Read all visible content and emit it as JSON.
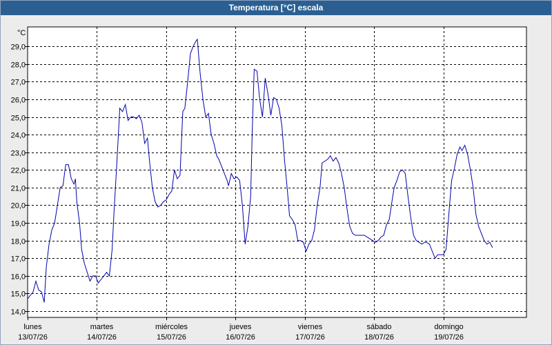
{
  "window": {
    "title": "Temperatura [°C] escala"
  },
  "chart_data": {
    "type": "line",
    "title": "Temperatura [°C] escala",
    "ylabel": "°C",
    "ylim": [
      13.65,
      30.1
    ],
    "yticks": [
      "14,0",
      "15,0",
      "16,0",
      "17,0",
      "18,0",
      "19,0",
      "20,0",
      "21,0",
      "22,0",
      "23,0",
      "24,0",
      "25,0",
      "26,0",
      "27,0",
      "28,0",
      "29,0"
    ],
    "yticks_values": [
      14,
      15,
      16,
      17,
      18,
      19,
      20,
      21,
      22,
      23,
      24,
      25,
      26,
      27,
      28,
      29
    ],
    "xlim": [
      0,
      7.2
    ],
    "xticks_values": [
      0,
      1,
      2,
      3,
      4,
      5,
      6
    ],
    "categories": [
      {
        "day": "lunes",
        "date": "13/07/26"
      },
      {
        "day": "martes",
        "date": "14/07/26"
      },
      {
        "day": "miércoles",
        "date": "15/07/26"
      },
      {
        "day": "jueves",
        "date": "16/07/26"
      },
      {
        "day": "viernes",
        "date": "17/07/26"
      },
      {
        "day": "sábado",
        "date": "18/07/26"
      },
      {
        "day": "domingo",
        "date": "19/07/26"
      }
    ],
    "grid": true,
    "line_color": "#0000aa",
    "series": [
      {
        "points": [
          [
            0.0,
            14.7
          ],
          [
            0.04,
            14.9
          ],
          [
            0.08,
            15.1
          ],
          [
            0.12,
            15.7
          ],
          [
            0.16,
            15.2
          ],
          [
            0.2,
            15.1
          ],
          [
            0.24,
            14.5
          ],
          [
            0.27,
            16.5
          ],
          [
            0.31,
            17.8
          ],
          [
            0.35,
            18.6
          ],
          [
            0.39,
            19.0
          ],
          [
            0.43,
            20.0
          ],
          [
            0.47,
            21.0
          ],
          [
            0.51,
            21.1
          ],
          [
            0.55,
            22.3
          ],
          [
            0.59,
            22.3
          ],
          [
            0.63,
            21.5
          ],
          [
            0.67,
            21.2
          ],
          [
            0.69,
            21.5
          ],
          [
            0.71,
            20.2
          ],
          [
            0.75,
            19.0
          ],
          [
            0.78,
            17.5
          ],
          [
            0.82,
            16.7
          ],
          [
            0.86,
            16.2
          ],
          [
            0.9,
            15.7
          ],
          [
            0.94,
            16.0
          ],
          [
            0.98,
            16.0
          ],
          [
            1.02,
            15.6
          ],
          [
            1.06,
            15.8
          ],
          [
            1.1,
            16.0
          ],
          [
            1.14,
            16.2
          ],
          [
            1.18,
            16.0
          ],
          [
            1.22,
            17.5
          ],
          [
            1.25,
            19.8
          ],
          [
            1.29,
            22.5
          ],
          [
            1.33,
            25.5
          ],
          [
            1.37,
            25.3
          ],
          [
            1.41,
            25.7
          ],
          [
            1.45,
            24.8
          ],
          [
            1.49,
            25.0
          ],
          [
            1.53,
            25.0
          ],
          [
            1.57,
            24.9
          ],
          [
            1.61,
            25.1
          ],
          [
            1.65,
            24.7
          ],
          [
            1.69,
            23.5
          ],
          [
            1.73,
            23.8
          ],
          [
            1.76,
            22.5
          ],
          [
            1.8,
            21.0
          ],
          [
            1.84,
            20.2
          ],
          [
            1.88,
            19.9
          ],
          [
            1.92,
            20.0
          ],
          [
            1.96,
            20.2
          ],
          [
            2.0,
            20.3
          ],
          [
            2.04,
            20.6
          ],
          [
            2.08,
            20.8
          ],
          [
            2.12,
            22.0
          ],
          [
            2.16,
            21.5
          ],
          [
            2.2,
            21.7
          ],
          [
            2.24,
            25.3
          ],
          [
            2.27,
            25.5
          ],
          [
            2.31,
            27.0
          ],
          [
            2.35,
            28.6
          ],
          [
            2.39,
            29.0
          ],
          [
            2.43,
            29.3
          ],
          [
            2.45,
            29.4
          ],
          [
            2.49,
            27.5
          ],
          [
            2.53,
            26.0
          ],
          [
            2.57,
            25.0
          ],
          [
            2.61,
            25.2
          ],
          [
            2.65,
            24.0
          ],
          [
            2.69,
            23.5
          ],
          [
            2.73,
            22.8
          ],
          [
            2.76,
            22.6
          ],
          [
            2.8,
            22.2
          ],
          [
            2.84,
            21.8
          ],
          [
            2.88,
            21.4
          ],
          [
            2.9,
            21.1
          ],
          [
            2.94,
            21.8
          ],
          [
            2.98,
            21.5
          ],
          [
            3.02,
            21.6
          ],
          [
            3.06,
            21.4
          ],
          [
            3.1,
            20.0
          ],
          [
            3.14,
            17.8
          ],
          [
            3.18,
            18.8
          ],
          [
            3.22,
            20.5
          ],
          [
            3.24,
            24.0
          ],
          [
            3.27,
            27.7
          ],
          [
            3.31,
            27.6
          ],
          [
            3.35,
            26.0
          ],
          [
            3.39,
            25.0
          ],
          [
            3.43,
            27.2
          ],
          [
            3.47,
            26.3
          ],
          [
            3.51,
            25.1
          ],
          [
            3.55,
            26.1
          ],
          [
            3.59,
            26.0
          ],
          [
            3.63,
            25.5
          ],
          [
            3.67,
            24.5
          ],
          [
            3.71,
            22.5
          ],
          [
            3.75,
            20.8
          ],
          [
            3.78,
            19.4
          ],
          [
            3.82,
            19.2
          ],
          [
            3.86,
            18.9
          ],
          [
            3.9,
            18.0
          ],
          [
            3.94,
            18.0
          ],
          [
            3.98,
            17.9
          ],
          [
            4.02,
            17.4
          ],
          [
            4.06,
            17.8
          ],
          [
            4.1,
            18.0
          ],
          [
            4.14,
            18.6
          ],
          [
            4.18,
            20.0
          ],
          [
            4.22,
            21.0
          ],
          [
            4.25,
            22.4
          ],
          [
            4.29,
            22.5
          ],
          [
            4.33,
            22.6
          ],
          [
            4.37,
            22.8
          ],
          [
            4.41,
            22.5
          ],
          [
            4.45,
            22.7
          ],
          [
            4.49,
            22.4
          ],
          [
            4.53,
            21.8
          ],
          [
            4.57,
            21.0
          ],
          [
            4.61,
            19.8
          ],
          [
            4.65,
            18.8
          ],
          [
            4.69,
            18.4
          ],
          [
            4.73,
            18.3
          ],
          [
            4.78,
            18.3
          ],
          [
            4.82,
            18.3
          ],
          [
            4.86,
            18.3
          ],
          [
            4.9,
            18.2
          ],
          [
            4.94,
            18.1
          ],
          [
            4.98,
            18.0
          ],
          [
            5.02,
            17.9
          ],
          [
            5.06,
            18.0
          ],
          [
            5.1,
            18.2
          ],
          [
            5.14,
            18.3
          ],
          [
            5.18,
            18.9
          ],
          [
            5.22,
            19.2
          ],
          [
            5.25,
            20.0
          ],
          [
            5.29,
            21.0
          ],
          [
            5.33,
            21.4
          ],
          [
            5.37,
            21.9
          ],
          [
            5.41,
            22.0
          ],
          [
            5.45,
            21.8
          ],
          [
            5.49,
            20.5
          ],
          [
            5.53,
            19.3
          ],
          [
            5.57,
            18.3
          ],
          [
            5.61,
            18.0
          ],
          [
            5.65,
            17.9
          ],
          [
            5.69,
            17.8
          ],
          [
            5.73,
            17.9
          ],
          [
            5.76,
            17.9
          ],
          [
            5.8,
            17.8
          ],
          [
            5.84,
            17.4
          ],
          [
            5.88,
            17.0
          ],
          [
            5.92,
            17.2
          ],
          [
            5.96,
            17.2
          ],
          [
            6.0,
            17.2
          ],
          [
            6.04,
            17.5
          ],
          [
            6.08,
            19.5
          ],
          [
            6.12,
            21.4
          ],
          [
            6.16,
            22.1
          ],
          [
            6.2,
            22.9
          ],
          [
            6.24,
            23.3
          ],
          [
            6.27,
            23.1
          ],
          [
            6.31,
            23.4
          ],
          [
            6.35,
            22.9
          ],
          [
            6.39,
            22.0
          ],
          [
            6.43,
            21.0
          ],
          [
            6.47,
            19.5
          ],
          [
            6.51,
            18.8
          ],
          [
            6.55,
            18.4
          ],
          [
            6.59,
            18.0
          ],
          [
            6.63,
            17.8
          ],
          [
            6.67,
            17.9
          ],
          [
            6.71,
            17.6
          ]
        ]
      }
    ]
  }
}
